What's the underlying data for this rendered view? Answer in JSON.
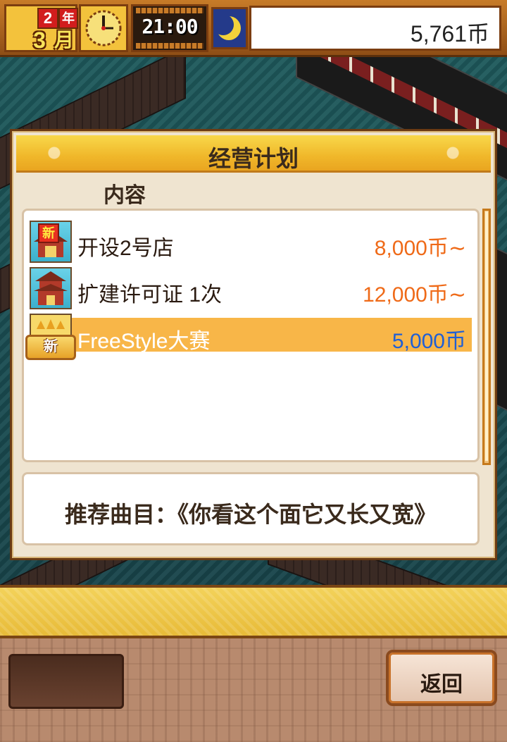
{
  "hud": {
    "year_num": "2",
    "year_label": "年",
    "month_num": "3",
    "month_label": "月",
    "time": "21:00",
    "money": "5,761币"
  },
  "dialog": {
    "title": "经营计划",
    "column_header": "内容",
    "items": [
      {
        "name": "开设2号店",
        "price": "8,000币∼",
        "badge": "新"
      },
      {
        "name": "扩建许可证 1次",
        "price": "12,000币∼"
      },
      {
        "name": "FreeStyle大赛",
        "price": "5,000币",
        "badge": "新",
        "selected": true
      }
    ],
    "description": "推荐曲目：《你看这个面它又长又宽》"
  },
  "footer": {
    "back_label": "返回"
  },
  "colors": {
    "price_orange": "#ef6a18",
    "price_blue": "#1f5fd6",
    "highlight": "#f8b648",
    "header_gold": "#f0b72a"
  }
}
